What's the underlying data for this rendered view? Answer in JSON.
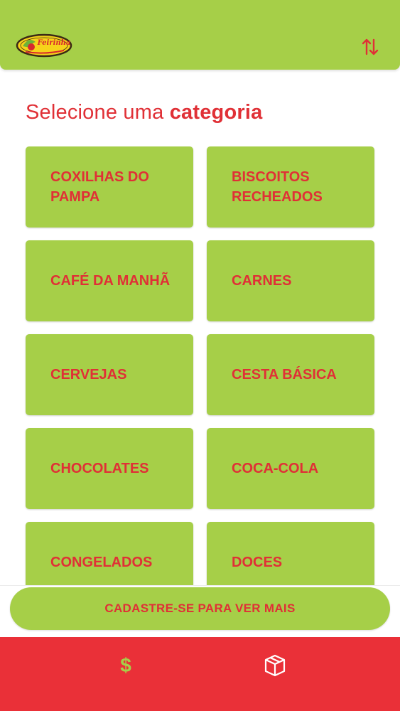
{
  "header": {
    "logo_text": "Feirinha",
    "sort_icon": "sort-arrows-icon"
  },
  "title": {
    "prefix": "Selecione uma",
    "emphasis": "categoria"
  },
  "categories": [
    {
      "label": "COXILHAS DO\nPAMPA"
    },
    {
      "label": "BISCOITOS\nRECHEADOS"
    },
    {
      "label": "CAFÉ DA MANHÃ"
    },
    {
      "label": "CARNES"
    },
    {
      "label": "CERVEJAS"
    },
    {
      "label": "CESTA BÁSICA"
    },
    {
      "label": "CHOCOLATES"
    },
    {
      "label": "COCA-COLA"
    },
    {
      "label": "CONGELADOS"
    },
    {
      "label": "DOCES"
    }
  ],
  "cta": {
    "label": "CADASTRE-SE PARA VER MAIS"
  },
  "bottom_nav": {
    "items": [
      {
        "icon": "dollar-icon",
        "glyph": "$"
      },
      {
        "icon": "box-icon"
      }
    ]
  },
  "colors": {
    "primary_green": "#a6cf48",
    "accent_red": "#e03036",
    "bottom_bar_red": "#ea3038"
  }
}
